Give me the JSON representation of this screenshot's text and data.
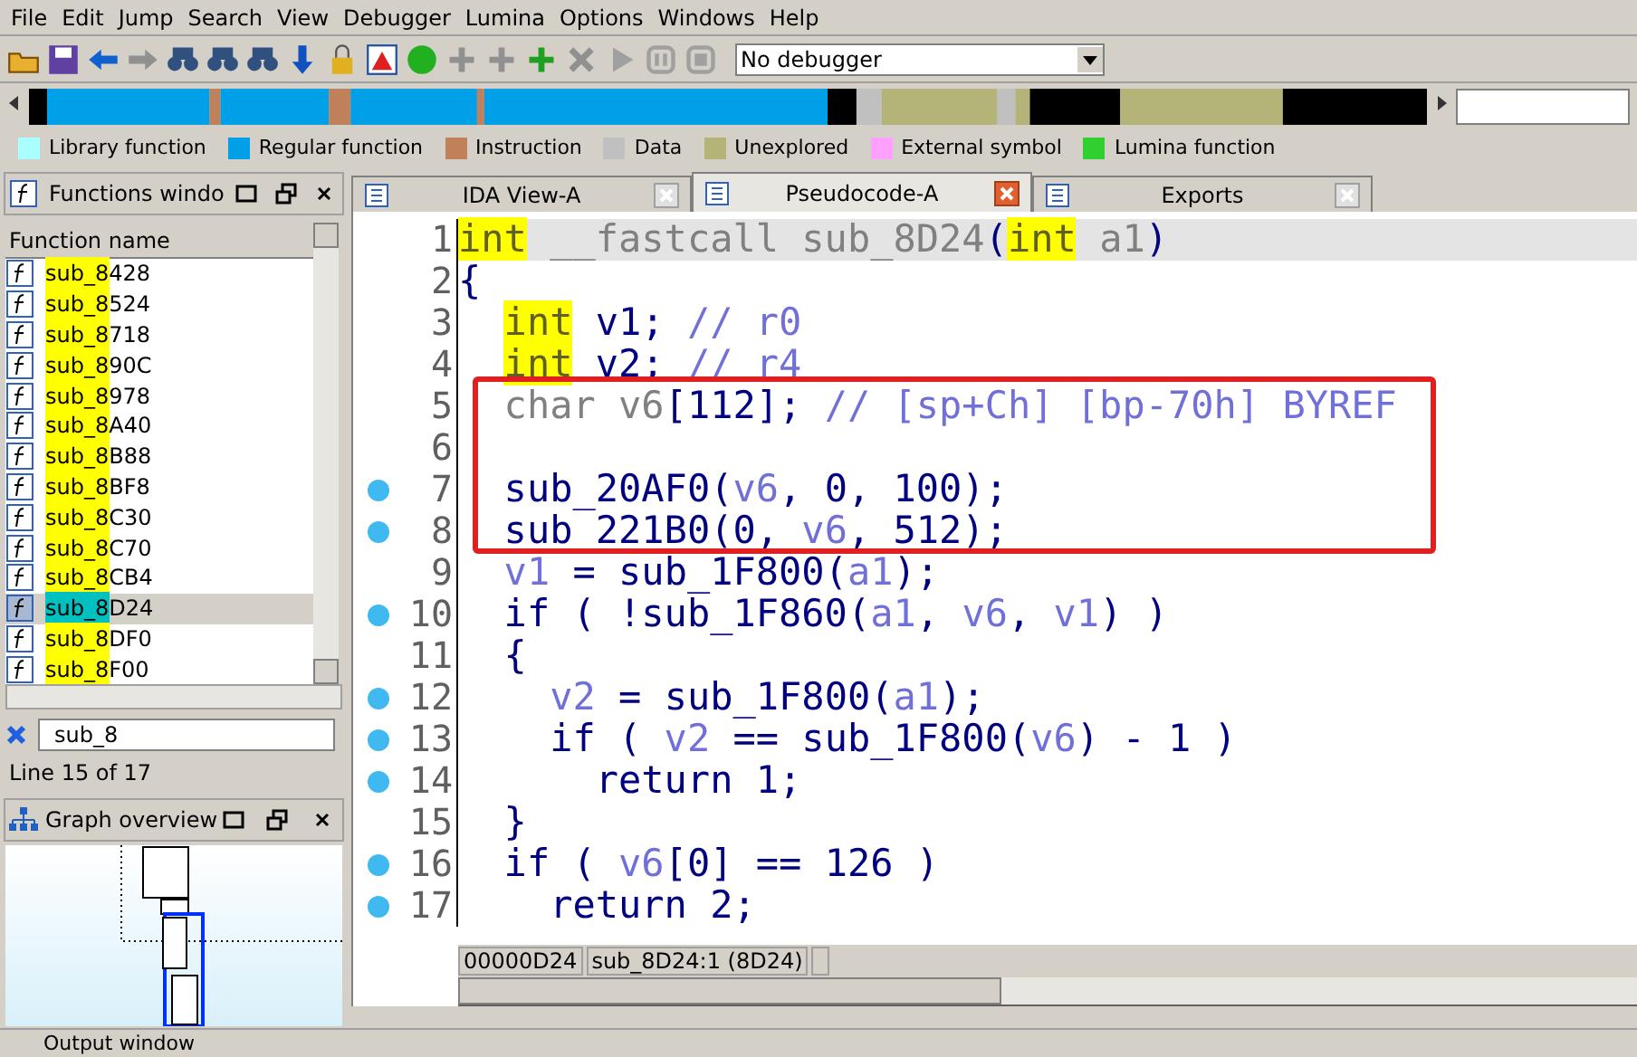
{
  "menu": [
    "File",
    "Edit",
    "Jump",
    "Search",
    "View",
    "Debugger",
    "Lumina",
    "Options",
    "Windows",
    "Help"
  ],
  "debugger_select": {
    "value": "No debugger"
  },
  "legend": [
    {
      "label": "Library function",
      "color": "#aaffff"
    },
    {
      "label": "Regular function",
      "color": "#00a0e8"
    },
    {
      "label": "Instruction",
      "color": "#c0805a"
    },
    {
      "label": "Data",
      "color": "#c0c0c0"
    },
    {
      "label": "Unexplored",
      "color": "#b4b478"
    },
    {
      "label": "External symbol",
      "color": "#ffa0ff"
    },
    {
      "label": "Lumina function",
      "color": "#30d030"
    }
  ],
  "functions_window": {
    "title": "Functions windo",
    "column": "Function name",
    "rows": [
      {
        "name": "sub_8428",
        "selected": false
      },
      {
        "name": "sub_8524",
        "selected": false
      },
      {
        "name": "sub_8718",
        "selected": false
      },
      {
        "name": "sub_890C",
        "selected": false
      },
      {
        "name": "sub_8978",
        "selected": false
      },
      {
        "name": "sub_8A40",
        "selected": false
      },
      {
        "name": "sub_8B88",
        "selected": false
      },
      {
        "name": "sub_8BF8",
        "selected": false
      },
      {
        "name": "sub_8C30",
        "selected": false
      },
      {
        "name": "sub_8C70",
        "selected": false
      },
      {
        "name": "sub_8CB4",
        "selected": false
      },
      {
        "name": "sub_8D24",
        "selected": true
      },
      {
        "name": "sub_8DF0",
        "selected": false
      },
      {
        "name": "sub_8F00",
        "selected": false
      }
    ],
    "search": {
      "value": "sub_8"
    },
    "status": "Line 15 of 17"
  },
  "graph_overview": {
    "title": "Graph overview"
  },
  "output_window": {
    "title": "Output window"
  },
  "tabs": [
    {
      "label": "IDA View-A",
      "selected": false
    },
    {
      "label": "Pseudocode-A",
      "selected": true
    },
    {
      "label": "Exports",
      "selected": false
    }
  ],
  "code": [
    {
      "number": "1",
      "dot": false,
      "current": true,
      "tokens": [
        {
          "kind": "kw",
          "text": "int"
        },
        {
          "kind": "decl",
          "text": " __fastcall sub_8D24"
        },
        {
          "kind": "plain",
          "text": "("
        },
        {
          "kind": "kw",
          "text": "int"
        },
        {
          "kind": "decl",
          "text": " a1"
        },
        {
          "kind": "plain",
          "text": ")"
        }
      ]
    },
    {
      "number": "2",
      "dot": false,
      "current": false,
      "tokens": [
        {
          "kind": "plain",
          "text": "{"
        }
      ]
    },
    {
      "number": "3",
      "dot": false,
      "current": false,
      "tokens": [
        {
          "kind": "kw",
          "text": "  int"
        },
        {
          "kind": "plain",
          "text": " v1; "
        },
        {
          "kind": "comment",
          "text": "// r0"
        }
      ]
    },
    {
      "number": "4",
      "dot": false,
      "current": false,
      "tokens": [
        {
          "kind": "kw",
          "text": "  int"
        },
        {
          "kind": "plain",
          "text": " v2; "
        },
        {
          "kind": "comment",
          "text": "// r4"
        }
      ]
    },
    {
      "number": "5",
      "dot": false,
      "current": false,
      "tokens": [
        {
          "kind": "decl",
          "text": "  char v6"
        },
        {
          "kind": "plain",
          "text": "[112]; "
        },
        {
          "kind": "comment",
          "text": "// [sp+Ch] [bp-70h] BYREF"
        }
      ]
    },
    {
      "number": "6",
      "dot": false,
      "current": false
    },
    {
      "number": "7",
      "dot": true,
      "current": false,
      "tokens": [
        {
          "kind": "plain",
          "text": "  sub_20AF0("
        },
        {
          "kind": "var",
          "text": "v6"
        },
        {
          "kind": "plain",
          "text": ", 0, 100);"
        }
      ]
    },
    {
      "number": "8",
      "dot": true,
      "current": false,
      "tokens": [
        {
          "kind": "plain",
          "text": "  sub_221B0(0, "
        },
        {
          "kind": "var",
          "text": "v6"
        },
        {
          "kind": "plain",
          "text": ", 512);"
        }
      ]
    },
    {
      "number": "9",
      "dot": false,
      "current": false,
      "tokens": [
        {
          "kind": "var",
          "text": "  v1"
        },
        {
          "kind": "plain",
          "text": " = sub_1F800("
        },
        {
          "kind": "var",
          "text": "a1"
        },
        {
          "kind": "plain",
          "text": ");"
        }
      ]
    },
    {
      "number": "10",
      "dot": true,
      "current": false,
      "tokens": [
        {
          "kind": "plain",
          "text": "  if ( !sub_1F860("
        },
        {
          "kind": "var",
          "text": "a1"
        },
        {
          "kind": "plain",
          "text": ", "
        },
        {
          "kind": "var",
          "text": "v6"
        },
        {
          "kind": "plain",
          "text": ", "
        },
        {
          "kind": "var",
          "text": "v1"
        },
        {
          "kind": "plain",
          "text": ") )"
        }
      ]
    },
    {
      "number": "11",
      "dot": false,
      "current": false,
      "tokens": [
        {
          "kind": "plain",
          "text": "  {"
        }
      ]
    },
    {
      "number": "12",
      "dot": true,
      "current": false,
      "tokens": [
        {
          "kind": "var",
          "text": "    v2"
        },
        {
          "kind": "plain",
          "text": " = sub_1F800("
        },
        {
          "kind": "var",
          "text": "a1"
        },
        {
          "kind": "plain",
          "text": ");"
        }
      ]
    },
    {
      "number": "13",
      "dot": true,
      "current": false,
      "tokens": [
        {
          "kind": "plain",
          "text": "    if ( "
        },
        {
          "kind": "var",
          "text": "v2"
        },
        {
          "kind": "plain",
          "text": " == sub_1F800("
        },
        {
          "kind": "var",
          "text": "v6"
        },
        {
          "kind": "plain",
          "text": ") - 1 )"
        }
      ]
    },
    {
      "number": "14",
      "dot": true,
      "current": false,
      "tokens": [
        {
          "kind": "plain",
          "text": "      return 1;"
        }
      ]
    },
    {
      "number": "15",
      "dot": false,
      "current": false,
      "tokens": [
        {
          "kind": "plain",
          "text": "  }"
        }
      ]
    },
    {
      "number": "16",
      "dot": true,
      "current": false,
      "tokens": [
        {
          "kind": "plain",
          "text": "  if ( "
        },
        {
          "kind": "var",
          "text": "v6"
        },
        {
          "kind": "plain",
          "text": "[0] == 126 )"
        }
      ]
    },
    {
      "number": "17",
      "dot": true,
      "current": false,
      "tokens": [
        {
          "kind": "plain",
          "text": "    return 2;"
        }
      ]
    }
  ],
  "code_status": [
    "00000D24",
    "sub_8D24:1 (8D24)"
  ]
}
